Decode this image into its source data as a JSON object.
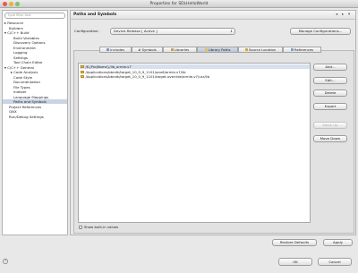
{
  "window": {
    "title": "Properties for SDLHelloWorld"
  },
  "sidebar": {
    "filter_placeholder": "type filter text",
    "items": [
      {
        "label": "▸ Resource"
      },
      {
        "label": "Builders"
      },
      {
        "label": "▾ C/C++ Build"
      },
      {
        "label": "Build Variables"
      },
      {
        "label": "Discovery Options"
      },
      {
        "label": "Environment"
      },
      {
        "label": "Logging"
      },
      {
        "label": "Settings"
      },
      {
        "label": "Tool Chain Editor"
      },
      {
        "label": "▾ C/C++ General"
      },
      {
        "label": "▸ Code Analysis"
      },
      {
        "label": "Code Style"
      },
      {
        "label": "Documentation"
      },
      {
        "label": "File Types"
      },
      {
        "label": "Indexer"
      },
      {
        "label": "Language Mappings"
      },
      {
        "label": "Paths and Symbols"
      },
      {
        "label": "Project References"
      },
      {
        "label": "QNX"
      },
      {
        "label": "Run/Debug Settings"
      }
    ]
  },
  "header": {
    "title": "Paths and Symbols",
    "back": "◂",
    "forward": "▸",
    "menu": "▾"
  },
  "config": {
    "label": "Configuration:",
    "value": "Device-Release  [ Active ]",
    "manage_label": "Manage Configurations..."
  },
  "tabs": [
    {
      "label": "Includes"
    },
    {
      "label": "# Symbols"
    },
    {
      "label": "Libraries"
    },
    {
      "label": "Library Paths"
    },
    {
      "label": "Source Location"
    },
    {
      "label": "References"
    }
  ],
  "paths": [
    {
      "text": "/${ProjName}/lib_armle-v7"
    },
    {
      "text": "/Applications/bbndk/target_10_0_9_1101/qnx6/armle-v7/lib"
    },
    {
      "text": "/Applications/bbndk/target_10_0_9_1101/target-override/armle-v7/usr/lib"
    }
  ],
  "side_buttons": {
    "add": "Add...",
    "edit": "Edit...",
    "delete": "Delete",
    "export": "Export",
    "move_up": "Move Up",
    "move_down": "Move Down"
  },
  "show_builtin": "Show built-in values",
  "restore_defaults": "Restore Defaults",
  "apply": "Apply",
  "ok": "OK",
  "cancel": "Cancel",
  "help": "?",
  "colors": {
    "accent": "#3b79c9",
    "folder": "#e8bf4a",
    "selection": "#c9d4e4"
  }
}
